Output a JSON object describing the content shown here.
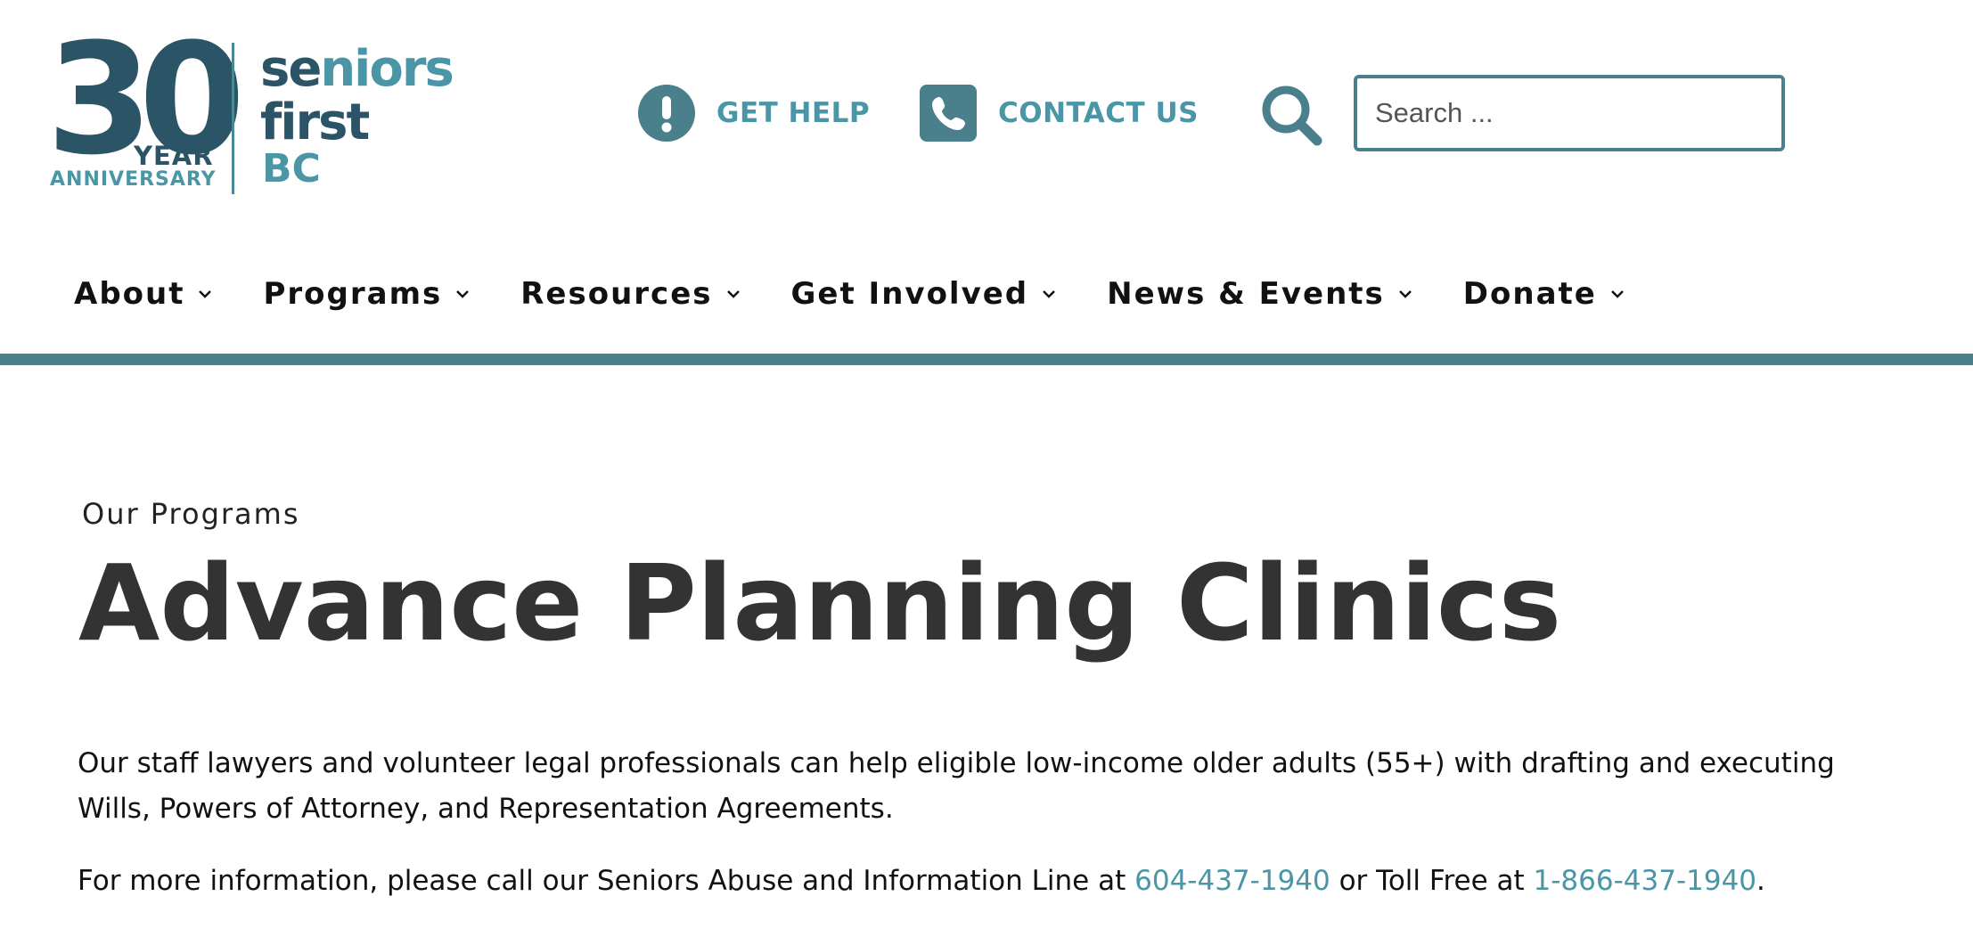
{
  "logo": {
    "number": "30",
    "year": "YEAR",
    "anniversary": "ANNIVERSARY",
    "line1_a": "se",
    "line1_b": "niors",
    "line2": "first",
    "line3": "BC"
  },
  "utility": {
    "get_help": {
      "label": "GET HELP",
      "icon": "exclamation-circle-icon"
    },
    "contact_us": {
      "label": "CONTACT US",
      "icon": "phone-icon"
    },
    "search": {
      "placeholder": "Search ...",
      "icon": "search-icon"
    }
  },
  "nav": {
    "items": [
      {
        "label": "About"
      },
      {
        "label": "Programs"
      },
      {
        "label": "Resources"
      },
      {
        "label": "Get Involved"
      },
      {
        "label": "News & Events"
      },
      {
        "label": "Donate"
      }
    ]
  },
  "main": {
    "eyebrow": "Our Programs",
    "title": "Advance Planning Clinics",
    "paragraph1": "Our staff lawyers and volunteer legal professionals can help eligible low-income older adults (55+) with drafting and executing Wills, Powers of Attorney, and Representation Agreements.",
    "paragraph2_prefix": "For more information, please call our Seniors Abuse and Information Line at ",
    "phone_local": "604-437-1940",
    "paragraph2_middle": " or Toll Free at ",
    "phone_tollfree": "1-866-437-1940",
    "paragraph2_suffix": "."
  },
  "colors": {
    "brand_dark": "#2b5566",
    "brand_teal": "#4a96a6",
    "rule": "#4a7f8c",
    "title_text": "#333333"
  }
}
